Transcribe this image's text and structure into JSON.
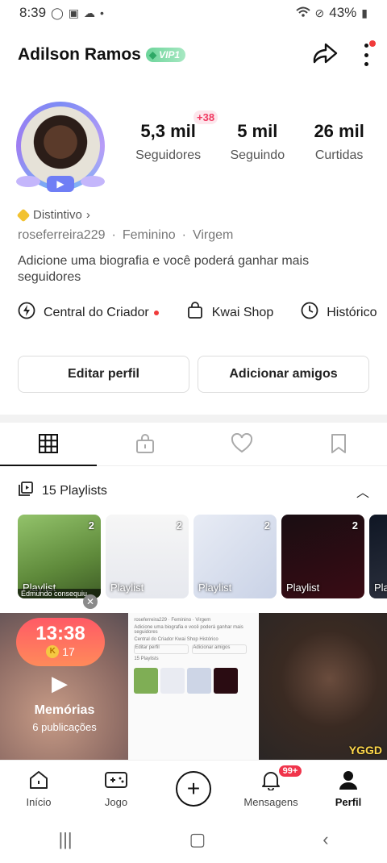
{
  "status_bar": {
    "time": "8:39",
    "battery": "43%"
  },
  "header": {
    "name": "Adilson Ramos",
    "vip_label": "VIP1"
  },
  "profile": {
    "new_followers_badge": "+38",
    "stats": [
      {
        "value": "5,3 mil",
        "label": "Seguidores"
      },
      {
        "value": "5 mil",
        "label": "Seguindo"
      },
      {
        "value": "26 mil",
        "label": "Curtidas"
      }
    ],
    "distintivo_label": "Distintivo",
    "username": "roseferreira229",
    "gender": "Feminino",
    "sign": "Virgem",
    "bio": "Adicione uma biografia e você poderá ganhar mais seguidores"
  },
  "quick_links": [
    {
      "label": "Central do Criador"
    },
    {
      "label": "Kwai Shop"
    },
    {
      "label": "Histórico"
    }
  ],
  "buttons": {
    "edit_profile": "Editar perfil",
    "add_friends": "Adicionar amigos"
  },
  "playlists": {
    "title": "15 Playlists",
    "items": [
      {
        "label": "Playlist",
        "count": "2",
        "caption": "Edmundo consequiu"
      },
      {
        "label": "Playlist",
        "count": "2"
      },
      {
        "label": "Playlist",
        "count": "2"
      },
      {
        "label": "Playlist",
        "count": "2"
      },
      {
        "label": "Pla"
      }
    ]
  },
  "grid": {
    "memories": {
      "timer": "13:38",
      "coins": "17",
      "title": "Memórias",
      "subtitle": "6 publicações"
    },
    "screenshot_cell": {
      "meta": "roseferreira229 · Feminino · Virgem",
      "bio": "Adicione uma biografia e você poderá ganhar mais seguidores",
      "links": "Central do Criador   Kwai Shop   Histórico",
      "edit": "Editar perfil",
      "add": "Adicionar amigos",
      "playlists": "15 Playlists"
    },
    "video_cell": {
      "watermark": "YGGD"
    }
  },
  "bottom_nav": [
    {
      "label": "Início"
    },
    {
      "label": "Jogo"
    },
    {
      "label": ""
    },
    {
      "label": "Mensagens",
      "badge": "99+"
    },
    {
      "label": "Perfil"
    }
  ]
}
